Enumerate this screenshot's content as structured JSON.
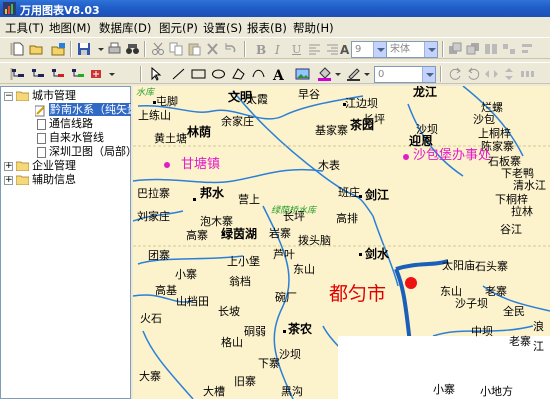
{
  "window": {
    "title": "万用图表V8.03"
  },
  "menu": [
    "工具(T)",
    "地图(M)",
    "数据库(D)",
    "图元(P)",
    "设置(S)",
    "报表(B)",
    "帮助(H)"
  ],
  "toolbar": {
    "font_size": "9",
    "font_family": "宋体",
    "line_width": "0"
  },
  "tree": {
    "items": [
      {
        "label": "城市管理",
        "level": 0,
        "expander": "−",
        "type": "folder-open"
      },
      {
        "label": "黔南水系（纯矢量",
        "level": 1,
        "type": "layer",
        "selected": true
      },
      {
        "label": "通信线路",
        "level": 1,
        "type": "doc"
      },
      {
        "label": "自来水管线",
        "level": 1,
        "type": "doc"
      },
      {
        "label": "深圳卫图（局部）",
        "level": 1,
        "type": "doc"
      },
      {
        "label": "企业管理",
        "level": 0,
        "expander": "+",
        "type": "folder"
      },
      {
        "label": "辅助信息",
        "level": 0,
        "expander": "+",
        "type": "folder"
      }
    ]
  },
  "map": {
    "background": "#fcf2cc",
    "river_color": "#2a80d8",
    "places": [
      {
        "text": "屯脚",
        "style": "normal"
      },
      {
        "text": "上练山",
        "style": "normal"
      },
      {
        "text": "黄土塘",
        "style": "normal"
      },
      {
        "text": "文明",
        "style": "bold"
      },
      {
        "text": "太霞",
        "style": "normal"
      },
      {
        "text": "早谷",
        "style": "normal"
      },
      {
        "text": "余家庄",
        "style": "normal"
      },
      {
        "text": "林荫",
        "style": "bold"
      },
      {
        "text": "江边坝",
        "style": "normal"
      },
      {
        "text": "龙江",
        "style": "bold"
      },
      {
        "text": "长坪",
        "style": "normal"
      },
      {
        "text": "基家寨",
        "style": "normal"
      },
      {
        "text": "茶园",
        "style": "bold"
      },
      {
        "text": "沙坝",
        "style": "normal"
      },
      {
        "text": "迎恩",
        "style": "bold"
      },
      {
        "text": "烂螺",
        "style": "normal"
      },
      {
        "text": "上桐梓",
        "style": "normal"
      },
      {
        "text": "陈家寨",
        "style": "normal"
      },
      {
        "text": "甘塘镇",
        "style": "pink"
      },
      {
        "text": "沙包堡办事处",
        "style": "pink"
      },
      {
        "text": "木表",
        "style": "normal"
      },
      {
        "text": "石板寨",
        "style": "normal"
      },
      {
        "text": "下老鸭",
        "style": "normal"
      },
      {
        "text": "清水江",
        "style": "normal"
      },
      {
        "text": "巴拉寨",
        "style": "normal"
      },
      {
        "text": "邦水",
        "style": "bold"
      },
      {
        "text": "班庄",
        "style": "normal"
      },
      {
        "text": "剑江",
        "style": "bold"
      },
      {
        "text": "营上",
        "style": "normal"
      },
      {
        "text": "绿荫桥水库",
        "style": "river"
      },
      {
        "text": "高排",
        "style": "normal"
      },
      {
        "text": "刘家庄",
        "style": "normal"
      },
      {
        "text": "泡木寨",
        "style": "normal"
      },
      {
        "text": "高寨",
        "style": "normal"
      },
      {
        "text": "绿茵湖",
        "style": "bold"
      },
      {
        "text": "岩寨",
        "style": "normal"
      },
      {
        "text": "拨头脑",
        "style": "normal"
      },
      {
        "text": "芦叶",
        "style": "normal"
      },
      {
        "text": "团寨",
        "style": "normal"
      },
      {
        "text": "上小堡",
        "style": "normal"
      },
      {
        "text": "东山",
        "style": "normal"
      },
      {
        "text": "剑水",
        "style": "bold"
      },
      {
        "text": "太阳庙",
        "style": "normal"
      },
      {
        "text": "石头寨",
        "style": "normal"
      },
      {
        "text": "小寨",
        "style": "normal"
      },
      {
        "text": "翁档",
        "style": "normal"
      },
      {
        "text": "都匀市",
        "style": "big-red"
      },
      {
        "text": "东山",
        "style": "normal"
      },
      {
        "text": "老寨",
        "style": "normal"
      },
      {
        "text": "高基",
        "style": "normal"
      },
      {
        "text": "山档田",
        "style": "normal"
      },
      {
        "text": "碗厂",
        "style": "normal"
      },
      {
        "text": "沙子坝",
        "style": "normal"
      },
      {
        "text": "全民",
        "style": "normal"
      },
      {
        "text": "长坡",
        "style": "normal"
      },
      {
        "text": "中坝",
        "style": "normal"
      },
      {
        "text": "硐弱",
        "style": "normal"
      },
      {
        "text": "茶农",
        "style": "bold"
      },
      {
        "text": "格山",
        "style": "normal"
      },
      {
        "text": "沙坝",
        "style": "normal"
      },
      {
        "text": "下寨",
        "style": "normal"
      },
      {
        "text": "旧寨",
        "style": "normal"
      },
      {
        "text": "大槽",
        "style": "normal"
      },
      {
        "text": "黑沟",
        "style": "normal"
      },
      {
        "text": "小地方",
        "style": "normal"
      },
      {
        "text": "谷江",
        "style": "normal"
      },
      {
        "text": "大寨",
        "style": "normal"
      },
      {
        "text": "火石",
        "style": "normal"
      },
      {
        "text": "水库",
        "style": "river"
      },
      {
        "text": "沙包",
        "style": "normal"
      },
      {
        "text": "下桐梓",
        "style": "normal"
      },
      {
        "text": "拉林",
        "style": "normal"
      },
      {
        "text": "长坪",
        "style": "normal"
      },
      {
        "text": "老寨",
        "style": "normal"
      },
      {
        "text": "小寨",
        "style": "normal"
      },
      {
        "text": "浪",
        "style": "normal"
      },
      {
        "text": "江",
        "style": "normal"
      }
    ]
  }
}
